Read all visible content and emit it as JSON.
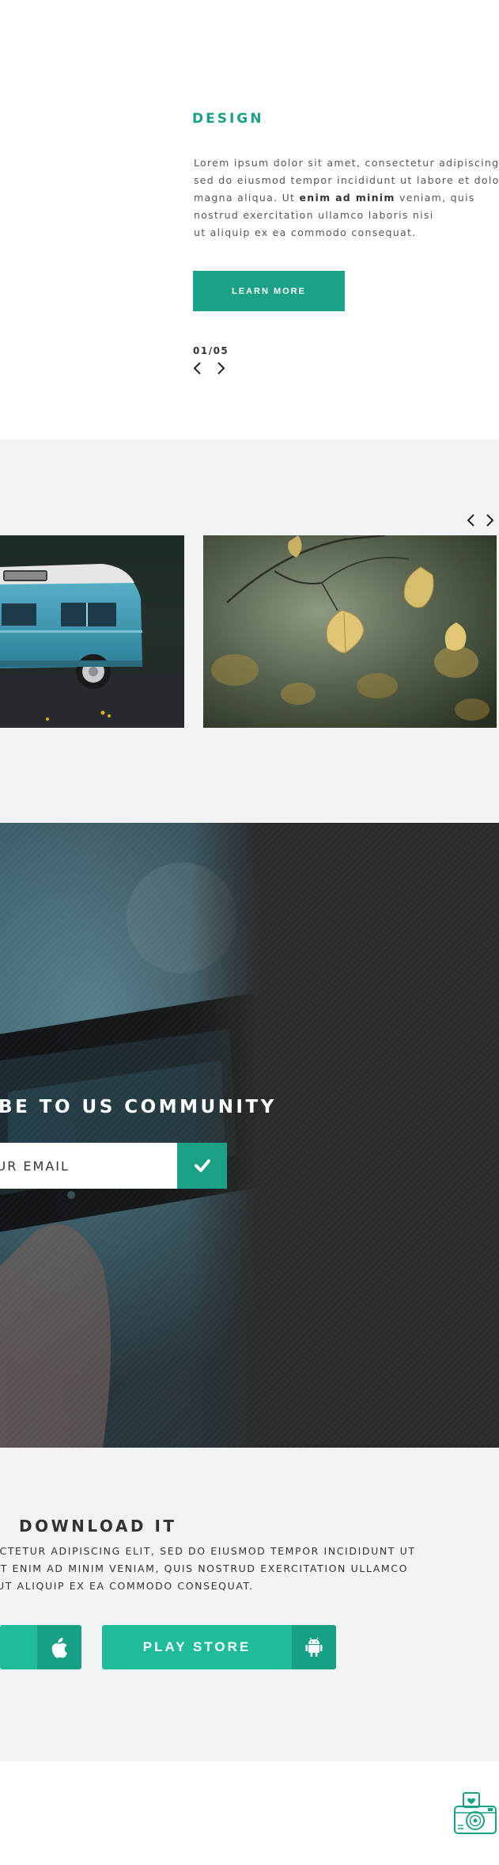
{
  "design": {
    "title": "DESIGN",
    "text_lines": [
      "Lorem ipsum dolor sit amet, consectetur adipiscing",
      "sed do eiusmod tempor incididunt ut labore et dolore",
      "magna aliqua. Ut ",
      "enim ad minim",
      " veniam, quis",
      "nostrud exercitation ullamco laboris nisi",
      "ut aliquip ex ea commodo consequat."
    ],
    "button_label": "LEARN MORE",
    "counter": "01/05"
  },
  "gallery": {
    "images": [
      "blue-vintage-van-photo",
      "autumn-leaves-photo"
    ]
  },
  "subscribe": {
    "heading": "IBE TO US COMMUNITY",
    "email_placeholder": "YOUR EMAIL"
  },
  "download": {
    "title": "DOWNLOAD IT",
    "text_lines": [
      "ECTETUR ADIPISCING ELIT, SED DO EIUSMOD TEMPOR INCIDIDUNT UT",
      "UT ENIM AD MINIM VENIAM, QUIS NOSTRUD EXERCITATION ULLAMCO",
      "UT ALIQUIP EX EA COMMODO CONSEQUAT."
    ],
    "play_store_label": "PLAY STORE",
    "app_store_icon": "apple-icon",
    "play_store_icon": "android-icon"
  },
  "colors": {
    "accent": "#1ba286",
    "accent_light": "#1ebc99",
    "section_gray": "#f2f3f5",
    "dark": "#2a2c2c"
  }
}
